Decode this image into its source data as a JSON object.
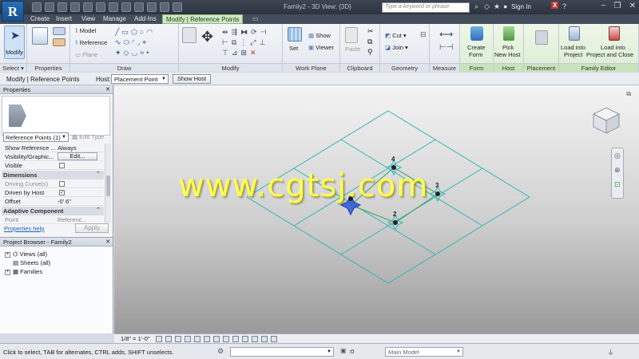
{
  "titlebar": {
    "title": "Family2 - 3D View: {3D}",
    "search_placeholder": "Type a keyword or phrase",
    "sign_in": "Sign In"
  },
  "tabs": [
    "Create",
    "Insert",
    "View",
    "Manage",
    "Add-Ins",
    "Modify | Reference Points"
  ],
  "ribbon": {
    "select": {
      "modify": "Modify",
      "title": "Select ▾"
    },
    "properties": {
      "title": "Properties"
    },
    "draw": {
      "model": "Model",
      "reference": "Reference",
      "plane": "Plane",
      "title": "Draw"
    },
    "modify": {
      "title": "Modify"
    },
    "work_plane": {
      "set": "Set",
      "show": "Show",
      "viewer": "Viewer",
      "title": "Work Plane"
    },
    "clipboard": {
      "paste": "Paste",
      "title": "Clipboard"
    },
    "geometry": {
      "cut": "Cut",
      "join": "Join",
      "title": "Geometry"
    },
    "measure": {
      "title": "Measure"
    },
    "form": {
      "create_form_1": "Create",
      "create_form_2": "Form",
      "title": "Form"
    },
    "host": {
      "pick_1": "Pick",
      "pick_2": "New Host",
      "title": "Host"
    },
    "placement": {
      "title": "Placement"
    },
    "family_editor": {
      "load_1": "Load into",
      "load_2": "Project",
      "load_close_1": "Load into",
      "load_close_2": "Project and Close",
      "title": "Family Editor"
    }
  },
  "optbar": {
    "context": "Modify | Reference Points",
    "host_label": "Host:",
    "host_value": "Placement Point",
    "show_host": "Show Host"
  },
  "properties": {
    "header": "Properties",
    "instance_select": "Reference Points (1)",
    "edit_type": "Edit Type",
    "rows": [
      {
        "key": "Show Reference ...",
        "value": "Always"
      },
      {
        "key": "Visibility/Graphic...",
        "value": "Edit..."
      },
      {
        "key": "Visible",
        "value": ""
      }
    ],
    "group_dimensions": "Dimensions",
    "dim_rows": [
      {
        "key": "Driving Curve(s)",
        "value": ""
      },
      {
        "key": "Driven by Host",
        "value": "✓"
      },
      {
        "key": "Offset",
        "value": "-0'  6\""
      }
    ],
    "group_adaptive": "Adaptive Component",
    "adaptive_rows": [
      {
        "key": "Point",
        "value": "Referenc..."
      }
    ],
    "help_link": "Properties help",
    "apply": "Apply"
  },
  "browser": {
    "header": "Project Browser - Family2",
    "items": [
      "Views (all)",
      "Sheets (all)",
      "Families"
    ]
  },
  "viewport": {
    "watermark": "www.cgtsj.com",
    "point_labels": [
      "4",
      "3",
      "2"
    ],
    "accent_cyan": "#2fb7b4",
    "accent_blue": "#2b56d8"
  },
  "viewbar": {
    "scale": "1/8\" = 1'-0\""
  },
  "statusbar": {
    "text": "Click to select, TAB for alternates, CTRL adds, SHIFT unselects.",
    "zero": ":0",
    "model": "Main Model"
  }
}
